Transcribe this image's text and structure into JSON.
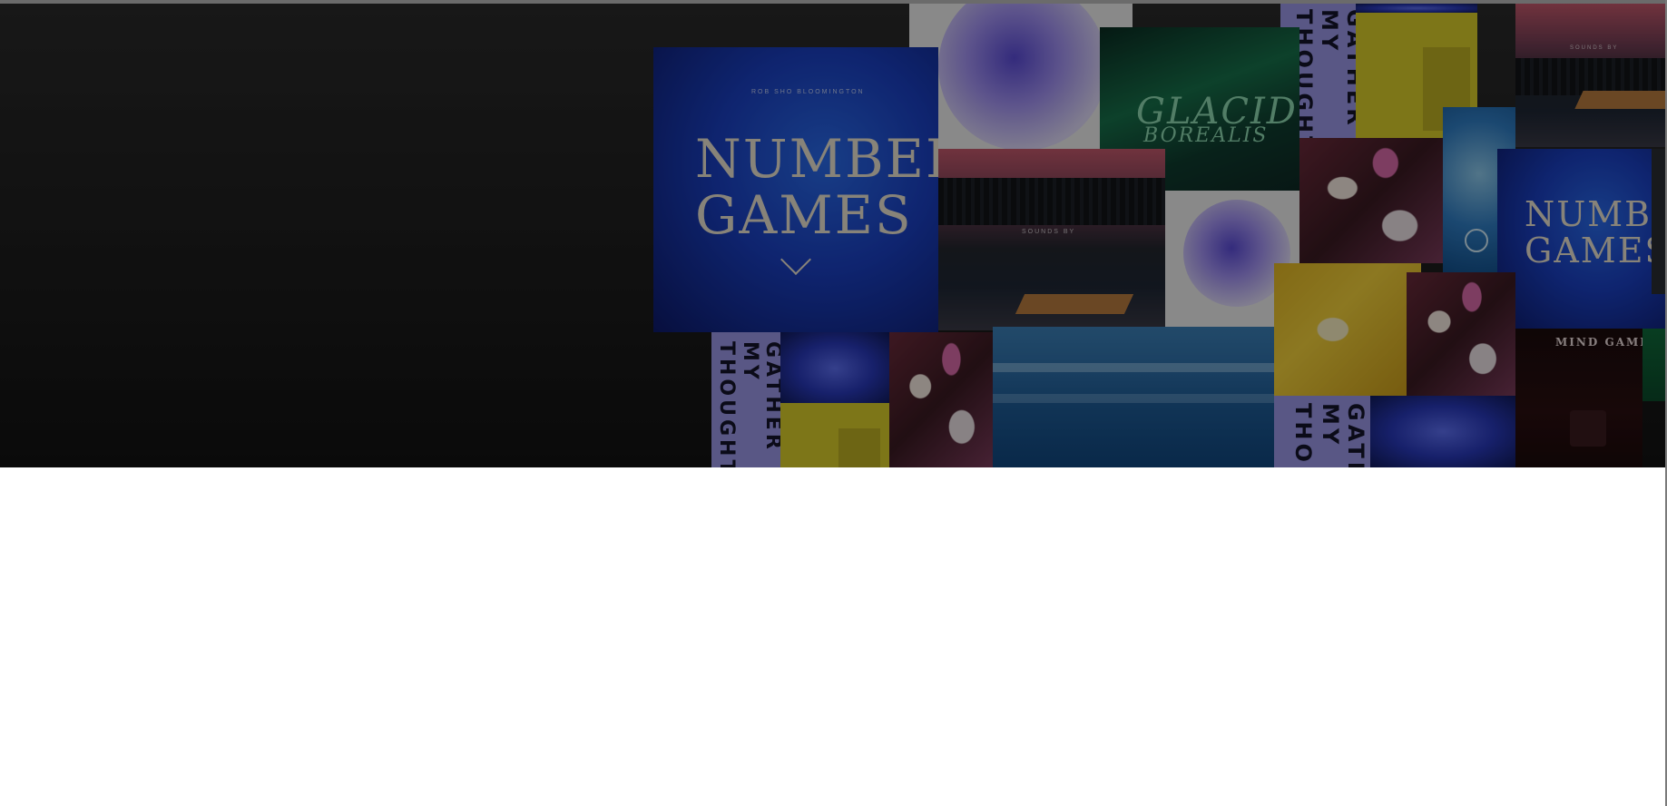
{
  "hero": {
    "background_colors": [
      "#2a2a2a",
      "#121212"
    ],
    "collage": {
      "covers": [
        {
          "name": "number-games",
          "title_lines": [
            "NUMBER",
            "GAMES"
          ],
          "kicker": "ROB SHO BLOOMINGTON"
        },
        {
          "name": "glacid-borealis",
          "title_lines": [
            "GLACID",
            "BOREALIS"
          ]
        },
        {
          "name": "gather-my-thoughts",
          "title_lines": [
            "GATHER MY",
            "THOUGHTS"
          ]
        },
        {
          "name": "mind-games",
          "title_lines": [
            "MIND GAME"
          ]
        },
        {
          "name": "lake-dock",
          "label": "SOUNDS BY"
        }
      ]
    }
  }
}
